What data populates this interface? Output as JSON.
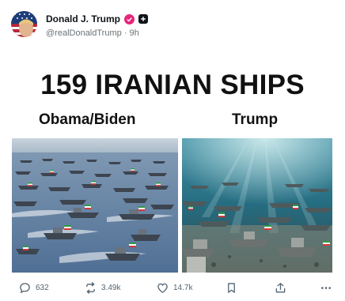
{
  "post": {
    "author_name": "Donald J. Trump",
    "handle": "@realDonaldTrump",
    "separator": "·",
    "time": "9h",
    "headline": "159 IRANIAN SHIPS",
    "left_label": "Obama/Biden",
    "right_label": "Trump"
  },
  "actions": {
    "replies": "632",
    "reposts": "3.49k",
    "likes": "14.7k"
  },
  "icons": {
    "verified": "verified-badge-icon",
    "follow": "follow-plus-icon",
    "reply": "comment-icon",
    "repost": "repost-icon",
    "like": "heart-icon",
    "bookmark": "bookmark-icon",
    "share": "share-icon",
    "more": "more-icon"
  },
  "colors": {
    "badge": "#e8267a",
    "text_muted": "#536471",
    "sea_left": "#5d7fa6",
    "sea_right": "#1f6e85"
  }
}
